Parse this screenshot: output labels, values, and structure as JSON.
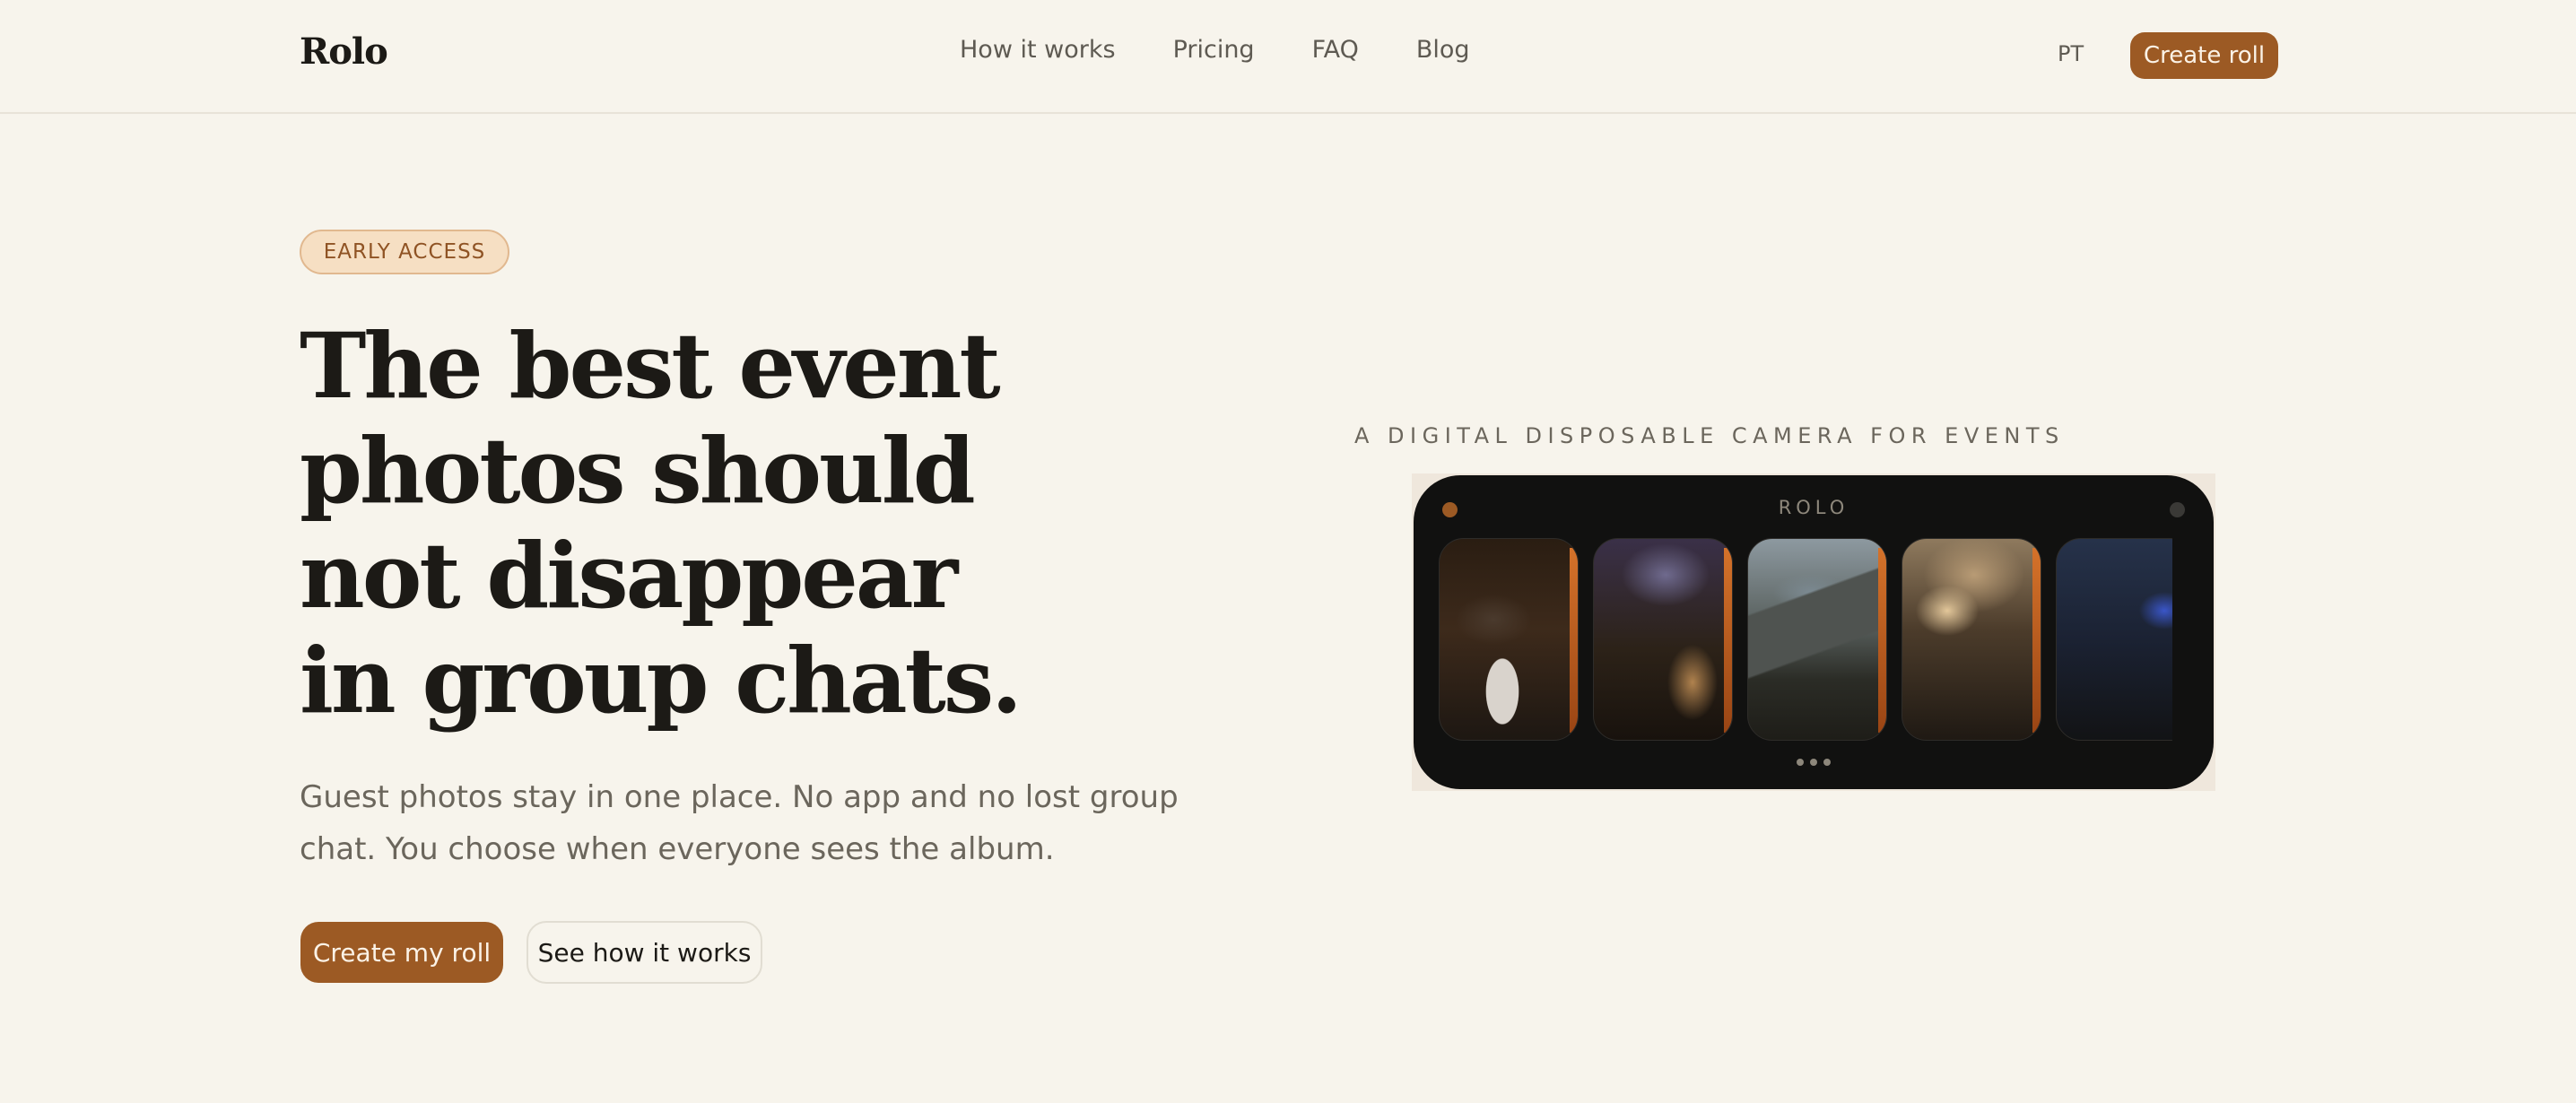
{
  "nav": {
    "logo": "Rolo",
    "links": [
      "How it works",
      "Pricing",
      "FAQ",
      "Blog"
    ],
    "language": "PT",
    "cta": "Create roll"
  },
  "hero": {
    "badge": "EARLY ACCESS",
    "headline": [
      "The best event",
      "photos should",
      "not disappear",
      "in group chats."
    ],
    "subtext_lines": [
      "Guest photos stay in one place. No app and no lost group",
      "chat. You choose when everyone sees the album."
    ],
    "primary_cta": "Create my roll",
    "secondary_cta": "See how it works"
  },
  "camera": {
    "eyebrow": "A DIGITAL DISPOSABLE CAMERA FOR EVENTS",
    "label": "ROLO",
    "frames": [
      "wedding-dance-photo",
      "party-crowd-photo",
      "lake-village-photo",
      "indoor-party-photo",
      "concert-crowd-photo"
    ],
    "pager_dots": 3
  },
  "colors": {
    "background": "#f7f4ec",
    "accent": "#9c5a24",
    "badge_bg": "#f6dfc3",
    "camera_body": "#111110"
  }
}
